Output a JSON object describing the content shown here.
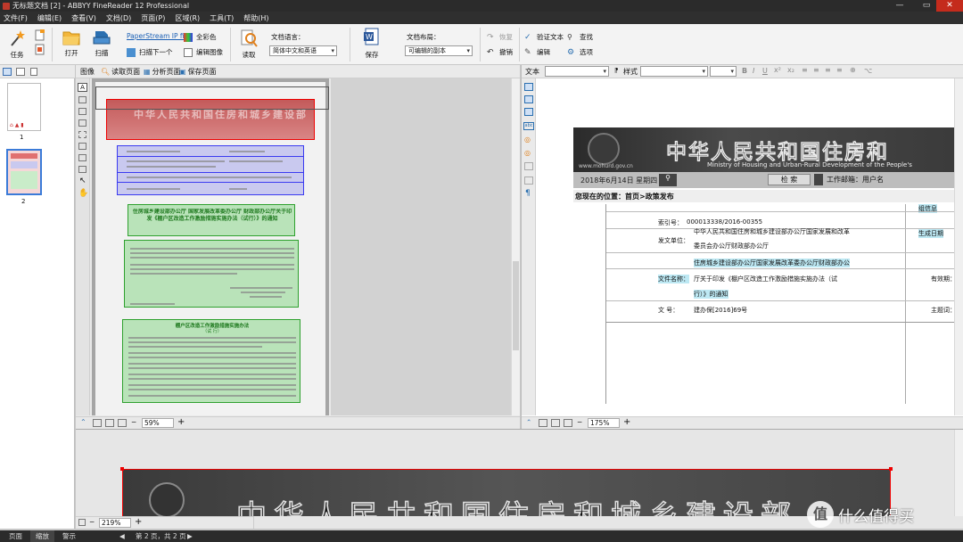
{
  "window": {
    "title": "无标题文档 [2] - ABBYY FineReader 12 Professional"
  },
  "menu": [
    "文件(F)",
    "编辑(E)",
    "查看(V)",
    "文档(D)",
    "页面(P)",
    "区域(R)",
    "工具(T)",
    "帮助(H)"
  ],
  "ribbon": {
    "task": "任务",
    "open": "打开",
    "scan": "扫描",
    "scanner_name": "PaperStream IP fi...",
    "scan_next": "扫描下一个",
    "full_color": "全彩色",
    "edit_image": "编辑图像",
    "read": "读取",
    "doc_lang_label": "文档语言：",
    "doc_lang_value": "简体中文和英语",
    "save": "保存",
    "layout_label": "文档布局：",
    "layout_value": "可编辑的副本",
    "restore": "恢复",
    "undo": "撤销",
    "verify_text": "验证文本",
    "find": "查找",
    "edit": "编辑",
    "options": "选项"
  },
  "image_toolbar": {
    "label": "图像",
    "read_page": "读取页面",
    "analyze_page": "分析页面",
    "save_page": "保存页面"
  },
  "text_toolbar": {
    "label": "文本",
    "style_label": "样式"
  },
  "thumbnails": [
    {
      "number": "1"
    },
    {
      "number": "2"
    }
  ],
  "image_zoom": "59%",
  "text_zoom": "175%",
  "bottom_zoom": "219%",
  "doc_image": {
    "header_text": "中华人民共和国住房和城乡建设部",
    "notice_title": "住房城乡建设部办公厅 国家发展改革委办公厅 财政部办公厅关于印发《棚户区改造工作激励措施实施办法（试行）》的通知",
    "attach_title": "棚户区改造工作激励措施实施办法",
    "attach_sub": "（试 行）"
  },
  "text_view": {
    "header_cn": "中华人民共和国住房和",
    "header_en": "Ministry of Housing and Urban-Rural Development of the People's",
    "url": "www.mohurd.gov.cn",
    "date_line": "2018年6月14日 星期四",
    "search_btn": "检    索",
    "mailbox": "工作邮箱：用户名",
    "position": "您现在的位置：首页>政策发布",
    "right_label1": "组信息",
    "index_label": "索引号：",
    "index_value": "000013338/2016-00355",
    "issuer_label": "发文单位：",
    "issuer_line1": "中华人民共和国住房和城乡建设部办公厅国家发展和改革",
    "issuer_line2": "委员会办公厅财政部办公厅",
    "issuer_line3": "住房城乡建设部办公厅国家发展改革委办公厅财政部办公",
    "right_label2": "生成日期",
    "title_label": "文件名称：",
    "title_line1": "厅关于印发《棚户区改造工作激励措施实施办法（试",
    "title_line2": "行）》的通知",
    "right_label3": "有效期：",
    "docno_label": "文  号：",
    "docno_value": "建办保[2016]69号",
    "right_label4": "主题词："
  },
  "zoom_view": {
    "header_text": "中华人民共和国住房和城乡建设部"
  },
  "status": {
    "tab_page": "页面",
    "tab_zoom": "缩放",
    "tab_warning": "警示",
    "page_info": "第 2 页，共 2 页"
  },
  "watermark": {
    "text": "什么值得买"
  },
  "colors": {
    "zone_red": "#e00000",
    "zone_blue": "#3a3af0",
    "zone_green": "#2fa12f",
    "highlight": "#bde8f3"
  }
}
